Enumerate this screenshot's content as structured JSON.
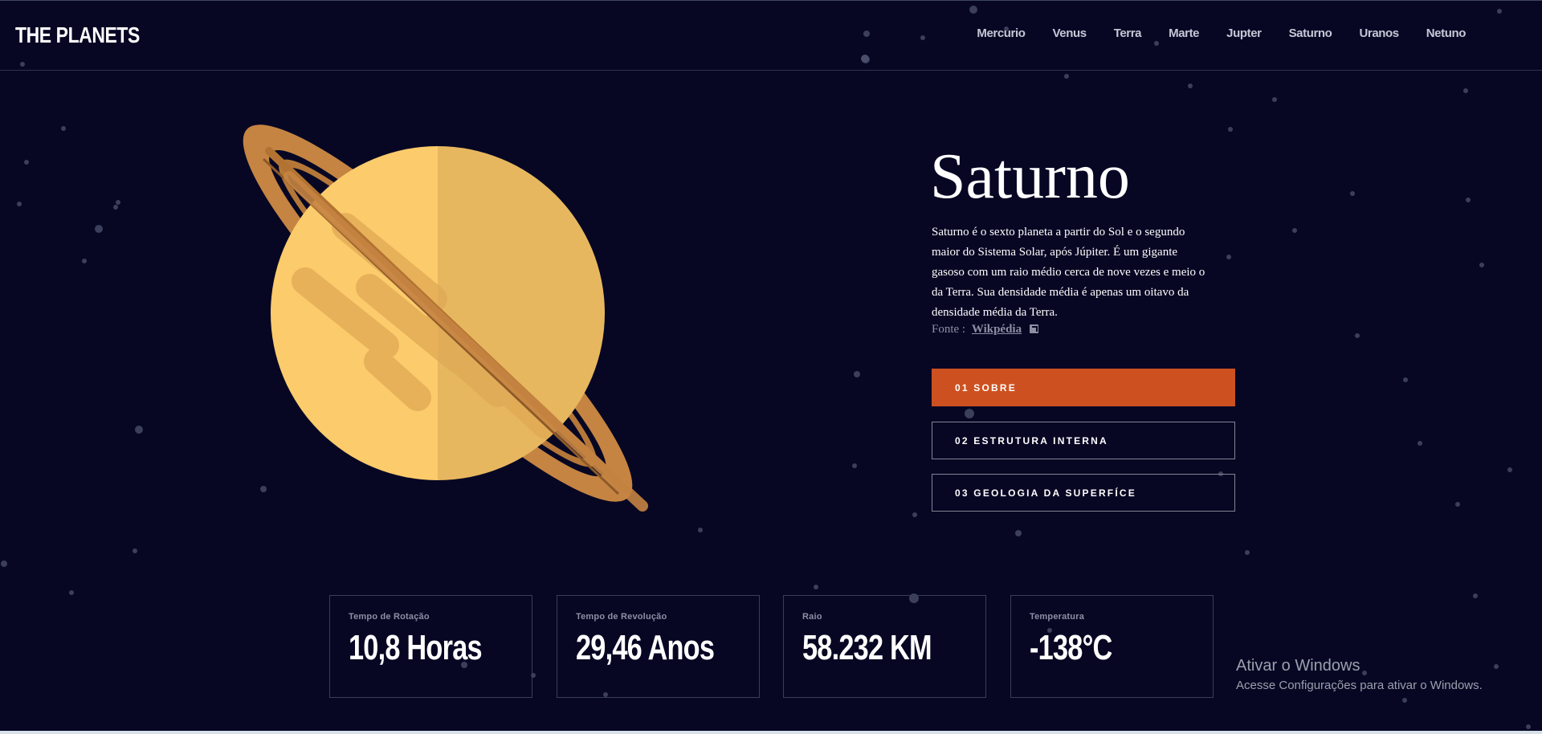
{
  "app": {
    "logo": "THE PLANETS"
  },
  "nav": [
    {
      "label": "Mercurio"
    },
    {
      "label": "Venus"
    },
    {
      "label": "Terra"
    },
    {
      "label": "Marte"
    },
    {
      "label": "Jupter"
    },
    {
      "label": "Saturno"
    },
    {
      "label": "Uranos"
    },
    {
      "label": "Netuno"
    }
  ],
  "planet": {
    "name": "Saturno",
    "description": "Saturno é o sexto planeta a partir do Sol e o segundo maior do Sistema Solar, após Júpiter. É um gigante gasoso com um raio médio cerca de nove vezes e meio o da Terra. Sua densidade média é apenas um oitavo da densidade média da Terra.",
    "source_label": "Fonte :",
    "source_link": "Wikpédia",
    "source_icon": "external-link-icon"
  },
  "tabs": [
    {
      "label": "01 SOBRE",
      "active": true
    },
    {
      "label": "02 ESTRUTURA INTERNA",
      "active": false
    },
    {
      "label": "03 GEOLOGIA DA SUPERFÍCE",
      "active": false
    }
  ],
  "stats": [
    {
      "label": "Tempo de Rotação",
      "value": "10,8 Horas"
    },
    {
      "label": "Tempo de Revolução",
      "value": "29,46 Anos"
    },
    {
      "label": "Raio",
      "value": "58.232 KM"
    },
    {
      "label": "Temperatura",
      "value": "-138°C"
    }
  ],
  "watermark": {
    "title": "Ativar o Windows",
    "subtitle": "Acesse Configurações para ativar o Windows."
  },
  "colors": {
    "background": "#070724",
    "accent": "#cd5120",
    "planet_light": "#FCCB6B",
    "planet_dark": "#E7B75F",
    "ring": "#C58442"
  }
}
